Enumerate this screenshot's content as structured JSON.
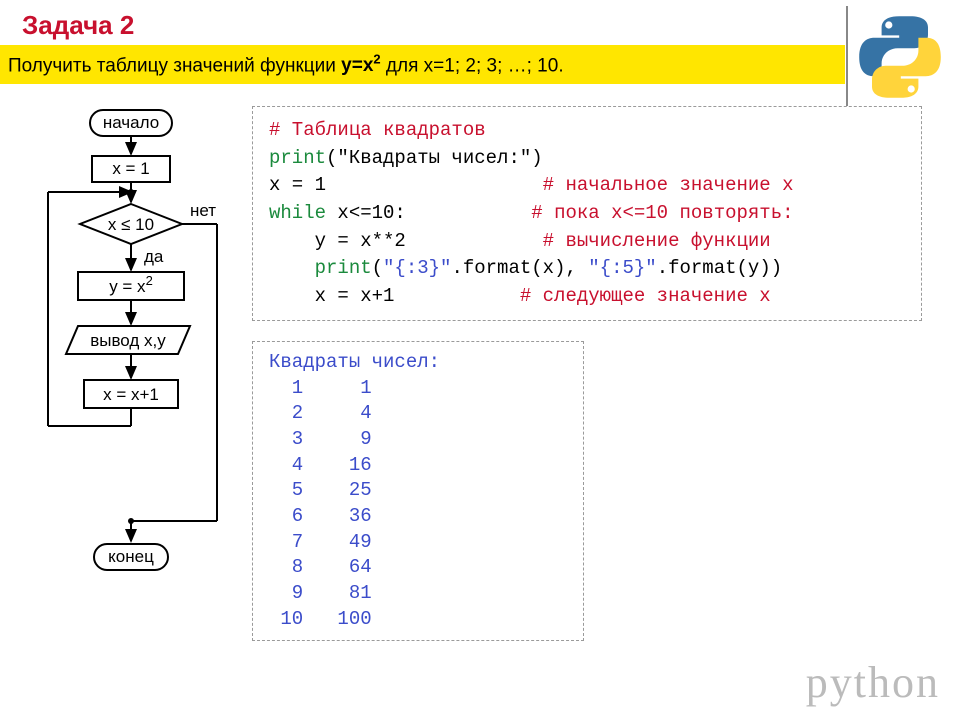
{
  "title": "Задача 2",
  "subtitle": {
    "lead": "Получить таблицу значений функции ",
    "func_lhs": "y=x",
    "func_exp": "2",
    "cond": " для x=1; 2; 3; …; 10."
  },
  "flow": {
    "start": "начало",
    "init": "x = 1",
    "cond": "x ≤ 10",
    "yes": "да",
    "no": "нет",
    "calc_l": "y = x",
    "calc_exp": "2",
    "out": "вывод x,y",
    "inc": "x = x+1",
    "end": "конец"
  },
  "code": {
    "l1": "# Таблица квадратов",
    "l2a": "print",
    "l2b": "(\"Квадраты чисел:\")",
    "l3a": "x = 1",
    "l3c": "# начальное значение x",
    "l4a": "while",
    "l4b": " x<=10:",
    "l4c": "# пока x<=10 повторять:",
    "l5a": "    y = x**2",
    "l5c": "# вычисление функции",
    "l6a": "    ",
    "l6b": "print",
    "l6c": "(",
    "l6d": "\"{:3}\"",
    "l6e": ".format(x), ",
    "l6f": "\"{:5}\"",
    "l6g": ".format(y))",
    "l7a": "    x = x+1",
    "l7c": "# следующее значение x"
  },
  "output_header": "Квадраты чисел:",
  "output_rows": [
    "  1     1",
    "  2     4",
    "  3     9",
    "  4    16",
    "  5    25",
    "  6    36",
    "  7    49",
    "  8    64",
    "  9    81",
    " 10   100"
  ],
  "watermark": "python"
}
